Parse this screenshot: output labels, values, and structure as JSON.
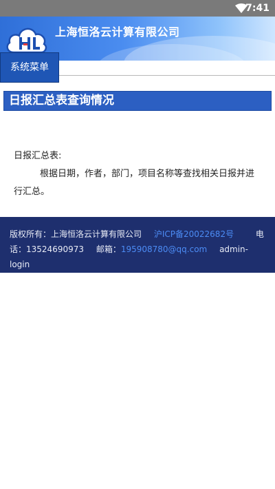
{
  "status_bar": {
    "time": "7:41",
    "wifi_icon": "wifi-icon"
  },
  "header": {
    "company_name": "上海恒洛云计算有限公司",
    "logo_icon": "cloud-logo-icon"
  },
  "nav": {
    "menu_label": "系统菜单"
  },
  "section": {
    "title": "日报汇总表查询情况"
  },
  "content": {
    "label": "日报汇总表:",
    "description": "根据日期，作者，部门，项目名称等查找相关日报并进行汇总。"
  },
  "footer": {
    "copyright": "版权所有：上海恒洛云计算有限公司",
    "icp": "沪ICP备20022682号",
    "phone_label": "电话：",
    "phone": "13524690973",
    "email_label": "邮箱：",
    "email": "195908780@qq.com",
    "admin_login": "admin-login"
  },
  "colors": {
    "banner_start": "#2f6fd8",
    "menu_button": "#1f56b5",
    "section_title": "#2c5fc2",
    "footer_bg": "#1e2f6e",
    "link": "#4c8cf5"
  }
}
